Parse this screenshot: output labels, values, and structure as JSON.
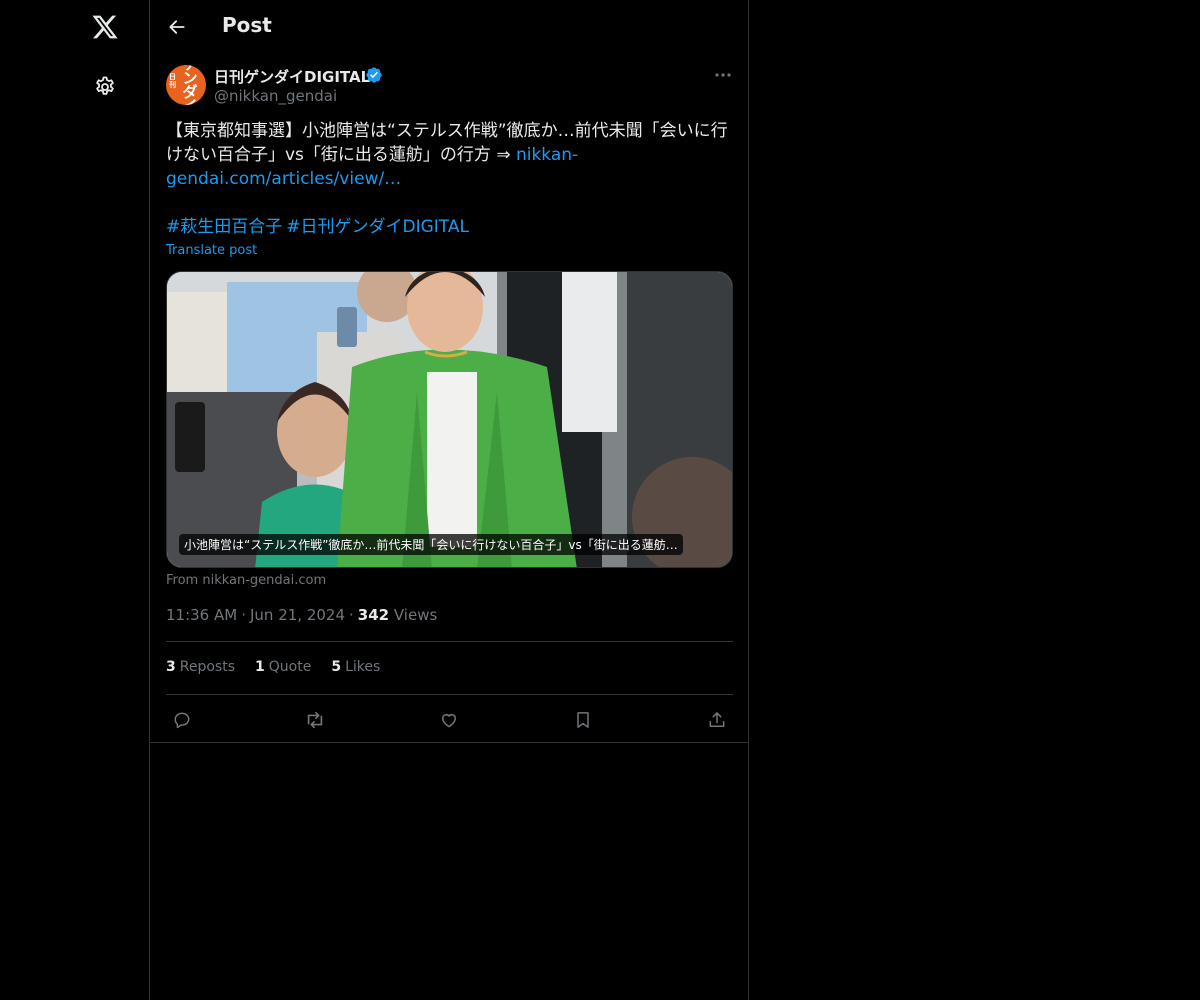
{
  "topbar": {
    "title": "Post"
  },
  "author": {
    "display_name": "日刊ゲンダイDIGITAL",
    "handle": "@nikkan_gendai",
    "avatar_text": "ゲンダイ"
  },
  "post": {
    "text": "【東京都知事選】小池陣営は“ステルス作戦”徹底か…前代未聞「会いに行けない百合子」vs「街に出る蓮舫」の行方 ⇒ ",
    "link": "nikkan-gendai.com/articles/view/…",
    "hashtags": [
      "#萩生田百合子",
      "#日刊ゲンダイDIGITAL"
    ],
    "translate_label": "Translate post"
  },
  "card": {
    "caption": "小池陣営は“ステルス作戦”徹底か…前代未聞「会いに行けない百合子」vs「街に出る蓮舫…",
    "source": "From nikkan-gendai.com"
  },
  "meta": {
    "time": "11:36 AM",
    "date": "Jun 21, 2024",
    "views_count": "342",
    "views_label": "Views"
  },
  "stats": {
    "reposts_count": "3",
    "reposts_label": "Reposts",
    "quotes_count": "1",
    "quotes_label": "Quote",
    "likes_count": "5",
    "likes_label": "Likes"
  },
  "icons": {
    "logo": "x-logo-icon",
    "settings": "gear-icon",
    "back": "arrow-left-icon",
    "more": "more-dots-icon",
    "verified": "verified-badge-icon",
    "reply": "reply-icon",
    "repost": "repost-icon",
    "like": "heart-icon",
    "bookmark": "bookmark-icon",
    "share": "share-icon"
  },
  "colors": {
    "background": "#000000",
    "accent": "#1d9bf0",
    "text": "#e7e9ea",
    "muted": "#71767b",
    "border": "#2f3336"
  }
}
